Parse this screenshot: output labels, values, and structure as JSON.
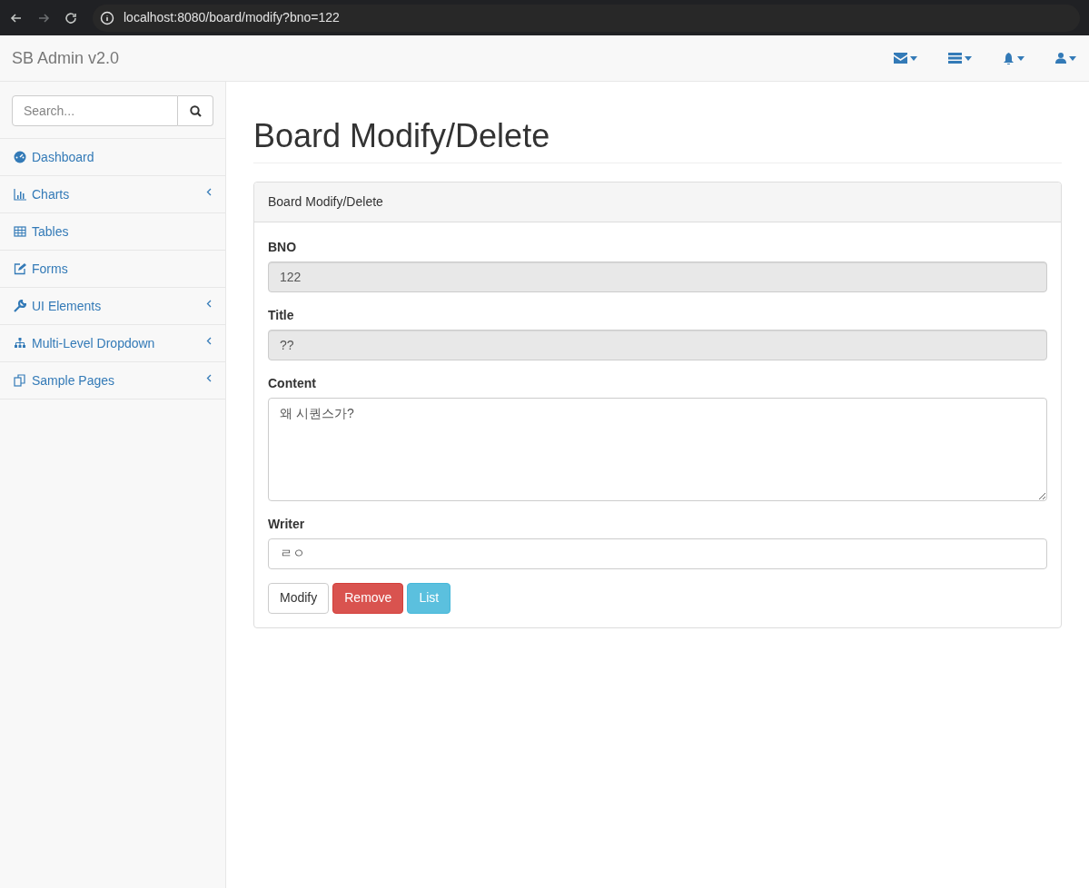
{
  "browser": {
    "url": "localhost:8080/board/modify?bno=122"
  },
  "navbar": {
    "brand": "SB Admin v2.0"
  },
  "sidebar": {
    "search": {
      "placeholder": "Search..."
    },
    "items": [
      {
        "label": "Dashboard",
        "expandable": false
      },
      {
        "label": "Charts",
        "expandable": true
      },
      {
        "label": "Tables",
        "expandable": false
      },
      {
        "label": "Forms",
        "expandable": false
      },
      {
        "label": "UI Elements",
        "expandable": true
      },
      {
        "label": "Multi-Level Dropdown",
        "expandable": true
      },
      {
        "label": "Sample Pages",
        "expandable": true
      }
    ]
  },
  "page": {
    "title": "Board Modify/Delete",
    "panel_heading": "Board Modify/Delete",
    "fields": [
      {
        "label": "BNO",
        "value": "122",
        "kind": "input",
        "readonly": true
      },
      {
        "label": "Title",
        "value": "??",
        "kind": "input",
        "readonly": true
      },
      {
        "label": "Content",
        "value": "왜 시퀀스가?",
        "kind": "textarea",
        "readonly": false
      },
      {
        "label": "Writer",
        "value": "ㄹㅇ",
        "kind": "input",
        "readonly": false
      }
    ],
    "buttons": [
      {
        "label": "Modify",
        "kind": "default"
      },
      {
        "label": "Remove",
        "kind": "danger"
      },
      {
        "label": "List",
        "kind": "info"
      }
    ]
  }
}
